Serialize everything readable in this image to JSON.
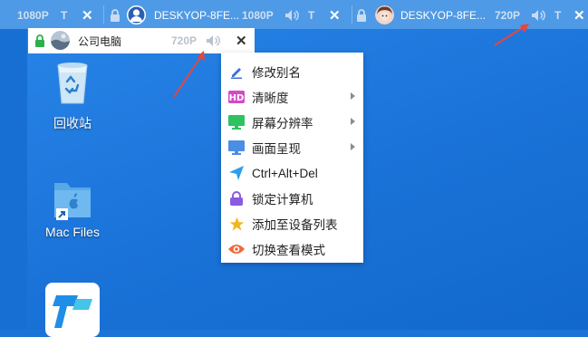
{
  "tabs": [
    {
      "name": "",
      "resolution": "1080P",
      "audio_icon": "",
      "t_label": "T",
      "close": "✕"
    },
    {
      "name": "DESKYOP-8FE...",
      "resolution": "1080P",
      "audio_icon": "speaker-icon",
      "t_label": "T",
      "close": "✕"
    },
    {
      "name": "DESKYOP-8FE...",
      "resolution": "720P",
      "audio_icon": "speaker-icon",
      "t_label": "T",
      "close": "✕"
    }
  ],
  "active_tab": {
    "name": "公司电脑",
    "resolution": "720P",
    "close": "✕"
  },
  "desktop_icons": [
    {
      "label": "回收站",
      "icon": "recycle-bin-icon"
    },
    {
      "label": "Mac Files",
      "icon": "folder-shortcut-icon"
    }
  ],
  "menu": {
    "items": [
      {
        "label": "修改别名",
        "icon": "pencil-icon",
        "submenu": false
      },
      {
        "label": "清晰度",
        "icon": "hd-icon",
        "submenu": true
      },
      {
        "label": "屏幕分辨率",
        "icon": "monitor-green-icon",
        "submenu": true
      },
      {
        "label": "画面呈现",
        "icon": "monitor-blue-icon",
        "submenu": true
      },
      {
        "label": "Ctrl+Alt+Del",
        "icon": "send-icon",
        "submenu": false
      },
      {
        "label": "锁定计算机",
        "icon": "lock-icon",
        "submenu": false
      },
      {
        "label": "添加至设备列表",
        "icon": "star-icon",
        "submenu": false
      },
      {
        "label": "切换查看模式",
        "icon": "eye-icon",
        "submenu": false
      }
    ]
  },
  "colors": {
    "tabbar": "#4f9ae6",
    "desktop": "#1b74d6",
    "arrow": "#e8453c",
    "lock_green": "#2bb14b"
  }
}
